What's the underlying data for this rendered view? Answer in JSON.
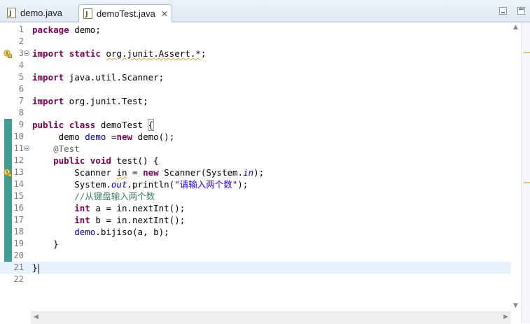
{
  "tabs": [
    {
      "label": "demo.java",
      "icon": "java-file-icon",
      "active": false
    },
    {
      "label": "demoTest.java",
      "icon": "java-file-icon",
      "active": true,
      "close": "✕"
    }
  ],
  "editor": {
    "current_line": 21,
    "lines": [
      {
        "n": "1",
        "html": "<span class=\"kw\">package</span> demo;"
      },
      {
        "n": "2",
        "html": ""
      },
      {
        "n": "3",
        "html": "<span class=\"kw\">import</span> <span class=\"kw\">static</span> <span class=\"warn-u\">org.junit.Assert.*</span>;",
        "fold": true,
        "warn": true
      },
      {
        "n": "4",
        "html": ""
      },
      {
        "n": "5",
        "html": "<span class=\"kw\">import</span> java.util.Scanner;"
      },
      {
        "n": "6",
        "html": ""
      },
      {
        "n": "7",
        "html": "<span class=\"kw\">import</span> org.junit.Test;"
      },
      {
        "n": "8",
        "html": ""
      },
      {
        "n": "9",
        "html": "<span class=\"kw\">public</span> <span class=\"kw\">class</span> demoTest <span class=\"brace-box\">{</span>"
      },
      {
        "n": "10",
        "html": "     demo <span class=\"fld\">demo</span> =<span class=\"kw\">new</span> demo();"
      },
      {
        "n": "11",
        "html": "    <span class=\"ann\">@Test</span>",
        "fold": true
      },
      {
        "n": "12",
        "html": "    <span class=\"kw\">public</span> <span class=\"kw\">void</span> test() {"
      },
      {
        "n": "13",
        "html": "        Scanner <span class=\"warn-u\">in</span> = <span class=\"kw\">new</span> Scanner(System.<span class=\"fld-it\">in</span>);",
        "warn": true
      },
      {
        "n": "14",
        "html": "        System.<span class=\"fld-it\">out</span>.println(<span class=\"st\">\"请输入两个数\"</span>);"
      },
      {
        "n": "15",
        "html": "        <span class=\"cm\">//从键盘输入两个数</span>"
      },
      {
        "n": "16",
        "html": "        <span class=\"kw\">int</span> a = in.nextInt();"
      },
      {
        "n": "17",
        "html": "        <span class=\"kw\">int</span> b = in.nextInt();"
      },
      {
        "n": "18",
        "html": "        <span class=\"fld\">demo</span>.bijiso(a, b);"
      },
      {
        "n": "19",
        "html": "    }"
      },
      {
        "n": "20",
        "html": ""
      },
      {
        "n": "21",
        "html": "}",
        "caret": true
      },
      {
        "n": "22",
        "html": ""
      }
    ]
  },
  "colors": {
    "keyword": "#7f0055",
    "comment": "#3f7f5f",
    "string": "#2a00ff",
    "field": "#0000c0",
    "change_ruler": "#3f9d93"
  }
}
